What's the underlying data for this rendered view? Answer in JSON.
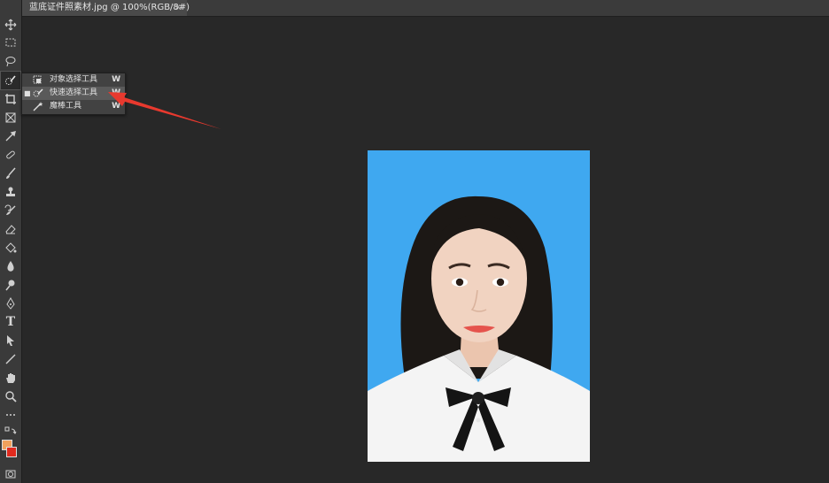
{
  "document_tab": {
    "title": "蓝底证件照素材.jpg @ 100%(RGB/8#)",
    "close": "×"
  },
  "toolbar": {
    "tools": [
      "move-icon",
      "marquee-icon",
      "lasso-icon",
      "quick-select-icon",
      "crop-icon",
      "frame-icon",
      "eyedropper-icon",
      "healing-icon",
      "brush-icon",
      "stamp-icon",
      "history-brush-icon",
      "eraser-icon",
      "paint-bucket-icon",
      "blur-icon",
      "dodge-icon",
      "pen-icon",
      "type-icon",
      "path-select-icon",
      "line-icon",
      "hand-icon",
      "zoom-icon",
      "more-icon",
      "swap-icon"
    ],
    "type_tool_label": "T",
    "foreground_color": "#f1a15c",
    "background_color": "#e12a1e"
  },
  "flyout": {
    "items": [
      {
        "label": "对象选择工具",
        "shortcut": "W",
        "selected": false
      },
      {
        "label": "快速选择工具",
        "shortcut": "W",
        "selected": true
      },
      {
        "label": "魔棒工具",
        "shortcut": "W",
        "selected": false
      }
    ],
    "selected_mark": "■"
  },
  "colors": {
    "canvas": "#282828",
    "photo_background": "#3fa8f0",
    "annotation_arrow": "#e8392e"
  }
}
